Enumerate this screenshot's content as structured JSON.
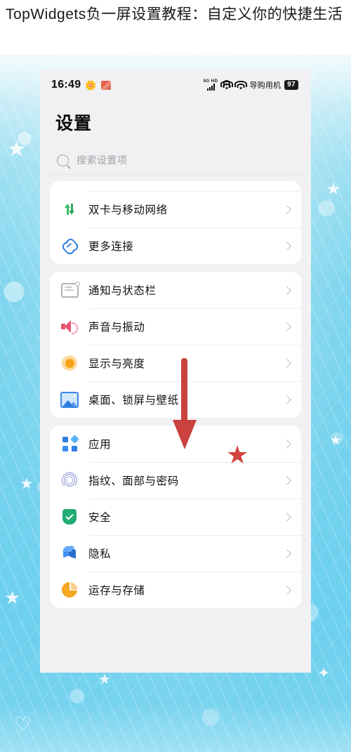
{
  "article": {
    "title": "TopWidgets负一屏设置教程：自定义你的快捷生活"
  },
  "colors": {
    "accent_red": "#c9423f",
    "background_blue": "#74d2ee",
    "card_white": "#ffffff",
    "page_gray": "#f1f1f3"
  },
  "phone": {
    "status_bar": {
      "time": "16:49",
      "emoji_1": "🌼",
      "emoji_2": "red-card-icon",
      "network_type": "5G",
      "network_hd": "HD",
      "carrier_label": "导购用机",
      "battery": "97"
    },
    "page_title": "设置",
    "search": {
      "placeholder": "搜索设置项",
      "value": ""
    },
    "cards": [
      {
        "name": "connectivity",
        "rows": [
          {
            "icon": "sim-network-icon",
            "label": "双卡与移动网络"
          },
          {
            "icon": "link-icon",
            "label": "更多连接"
          }
        ]
      },
      {
        "name": "display-sound",
        "rows": [
          {
            "icon": "notification-icon",
            "label": "通知与状态栏"
          },
          {
            "icon": "speaker-icon",
            "label": "声音与振动"
          },
          {
            "icon": "brightness-sun-icon",
            "label": "显示与亮度"
          },
          {
            "icon": "wallpaper-picture-icon",
            "label": "桌面、锁屏与壁纸"
          }
        ]
      },
      {
        "name": "apps-security",
        "rows": [
          {
            "icon": "apps-grid-icon",
            "label": "应用"
          },
          {
            "icon": "fingerprint-icon",
            "label": "指纹、面部与密码"
          },
          {
            "icon": "shield-check-icon",
            "label": "安全"
          },
          {
            "icon": "privacy-cube-icon",
            "label": "隐私"
          },
          {
            "icon": "storage-pie-icon",
            "label": "运存与存储"
          }
        ]
      }
    ]
  },
  "annotations": {
    "arrow": "red-down-arrow pointing at 桌面、锁屏与壁纸",
    "star": "★"
  }
}
